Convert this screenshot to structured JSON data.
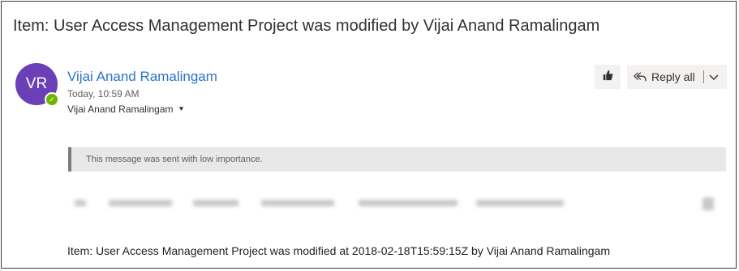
{
  "message": {
    "subject": "Item: User Access Management Project was modified by Vijai Anand Ramalingam",
    "avatar_initials": "VR",
    "sender_name": "Vijai Anand Ramalingam",
    "timestamp": "Today, 10:59 AM",
    "recipient": "Vijai Anand Ramalingam",
    "importance_notice": "This message was sent with low importance.",
    "body": "Item: User Access Management Project was modified at 2018-02-18T15:59:15Z by Vijai Anand Ramalingam"
  },
  "toolbar": {
    "like_icon": "thumbs-up-icon",
    "reply_all_label": "Reply all",
    "reply_icon": "reply-all-icon",
    "dropdown_icon": "chevron-down-icon"
  },
  "colors": {
    "avatar_bg": "#6b3fb6",
    "presence": "#6bb700",
    "link": "#2b74c8",
    "banner_bg": "#e8e8e8"
  }
}
